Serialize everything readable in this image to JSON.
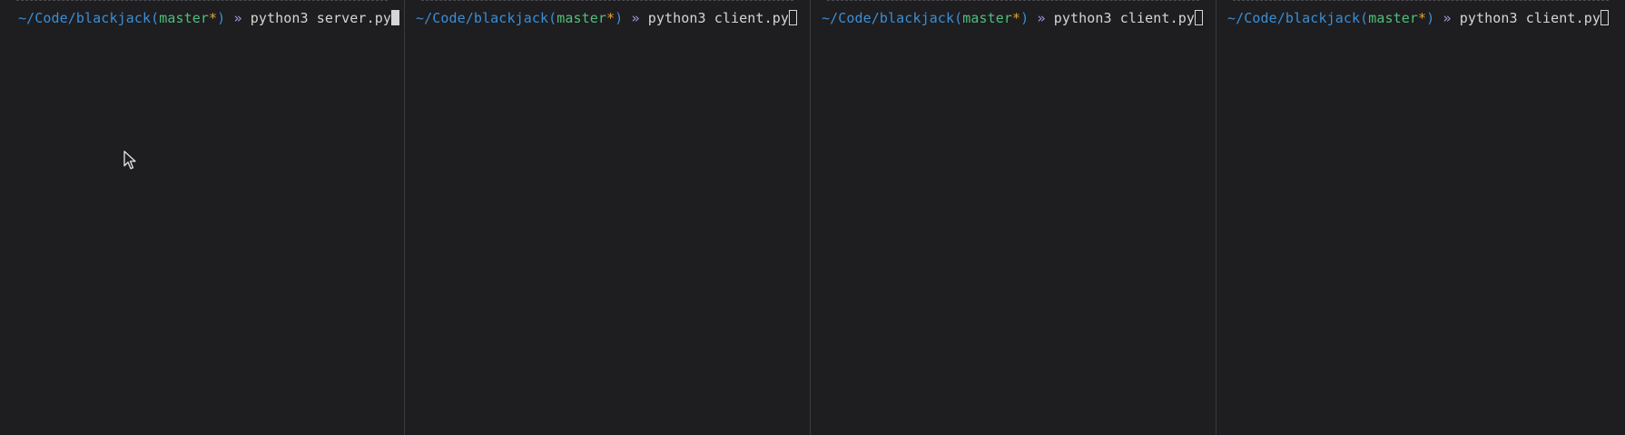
{
  "panes": [
    {
      "path": "~/Code/blackjack",
      "open_paren": "(",
      "branch": "master",
      "dirty": "*",
      "close_paren": ")",
      "arrow": "»",
      "command": "python3 server.py",
      "cursor_style": "block"
    },
    {
      "path": "~/Code/blackjack",
      "open_paren": "(",
      "branch": "master",
      "dirty": "*",
      "close_paren": ")",
      "arrow": "»",
      "command": "python3 client.py",
      "cursor_style": "hollow"
    },
    {
      "path": "~/Code/blackjack",
      "open_paren": "(",
      "branch": "master",
      "dirty": "*",
      "close_paren": ")",
      "arrow": "»",
      "command": "python3 client.py",
      "cursor_style": "hollow"
    },
    {
      "path": "~/Code/blackjack",
      "open_paren": "(",
      "branch": "master",
      "dirty": "*",
      "close_paren": ")",
      "arrow": "»",
      "command": "python3 client.py",
      "cursor_style": "hollow"
    }
  ],
  "colors": {
    "background": "#1e1d20",
    "path": "#3a8fd6",
    "branch": "#4fbf7a",
    "dirty": "#e0a43a",
    "arrow": "#9a9ae0",
    "command": "#d6d6d6"
  },
  "icons": {
    "mouse_pointer": "mouse-pointer-icon"
  }
}
